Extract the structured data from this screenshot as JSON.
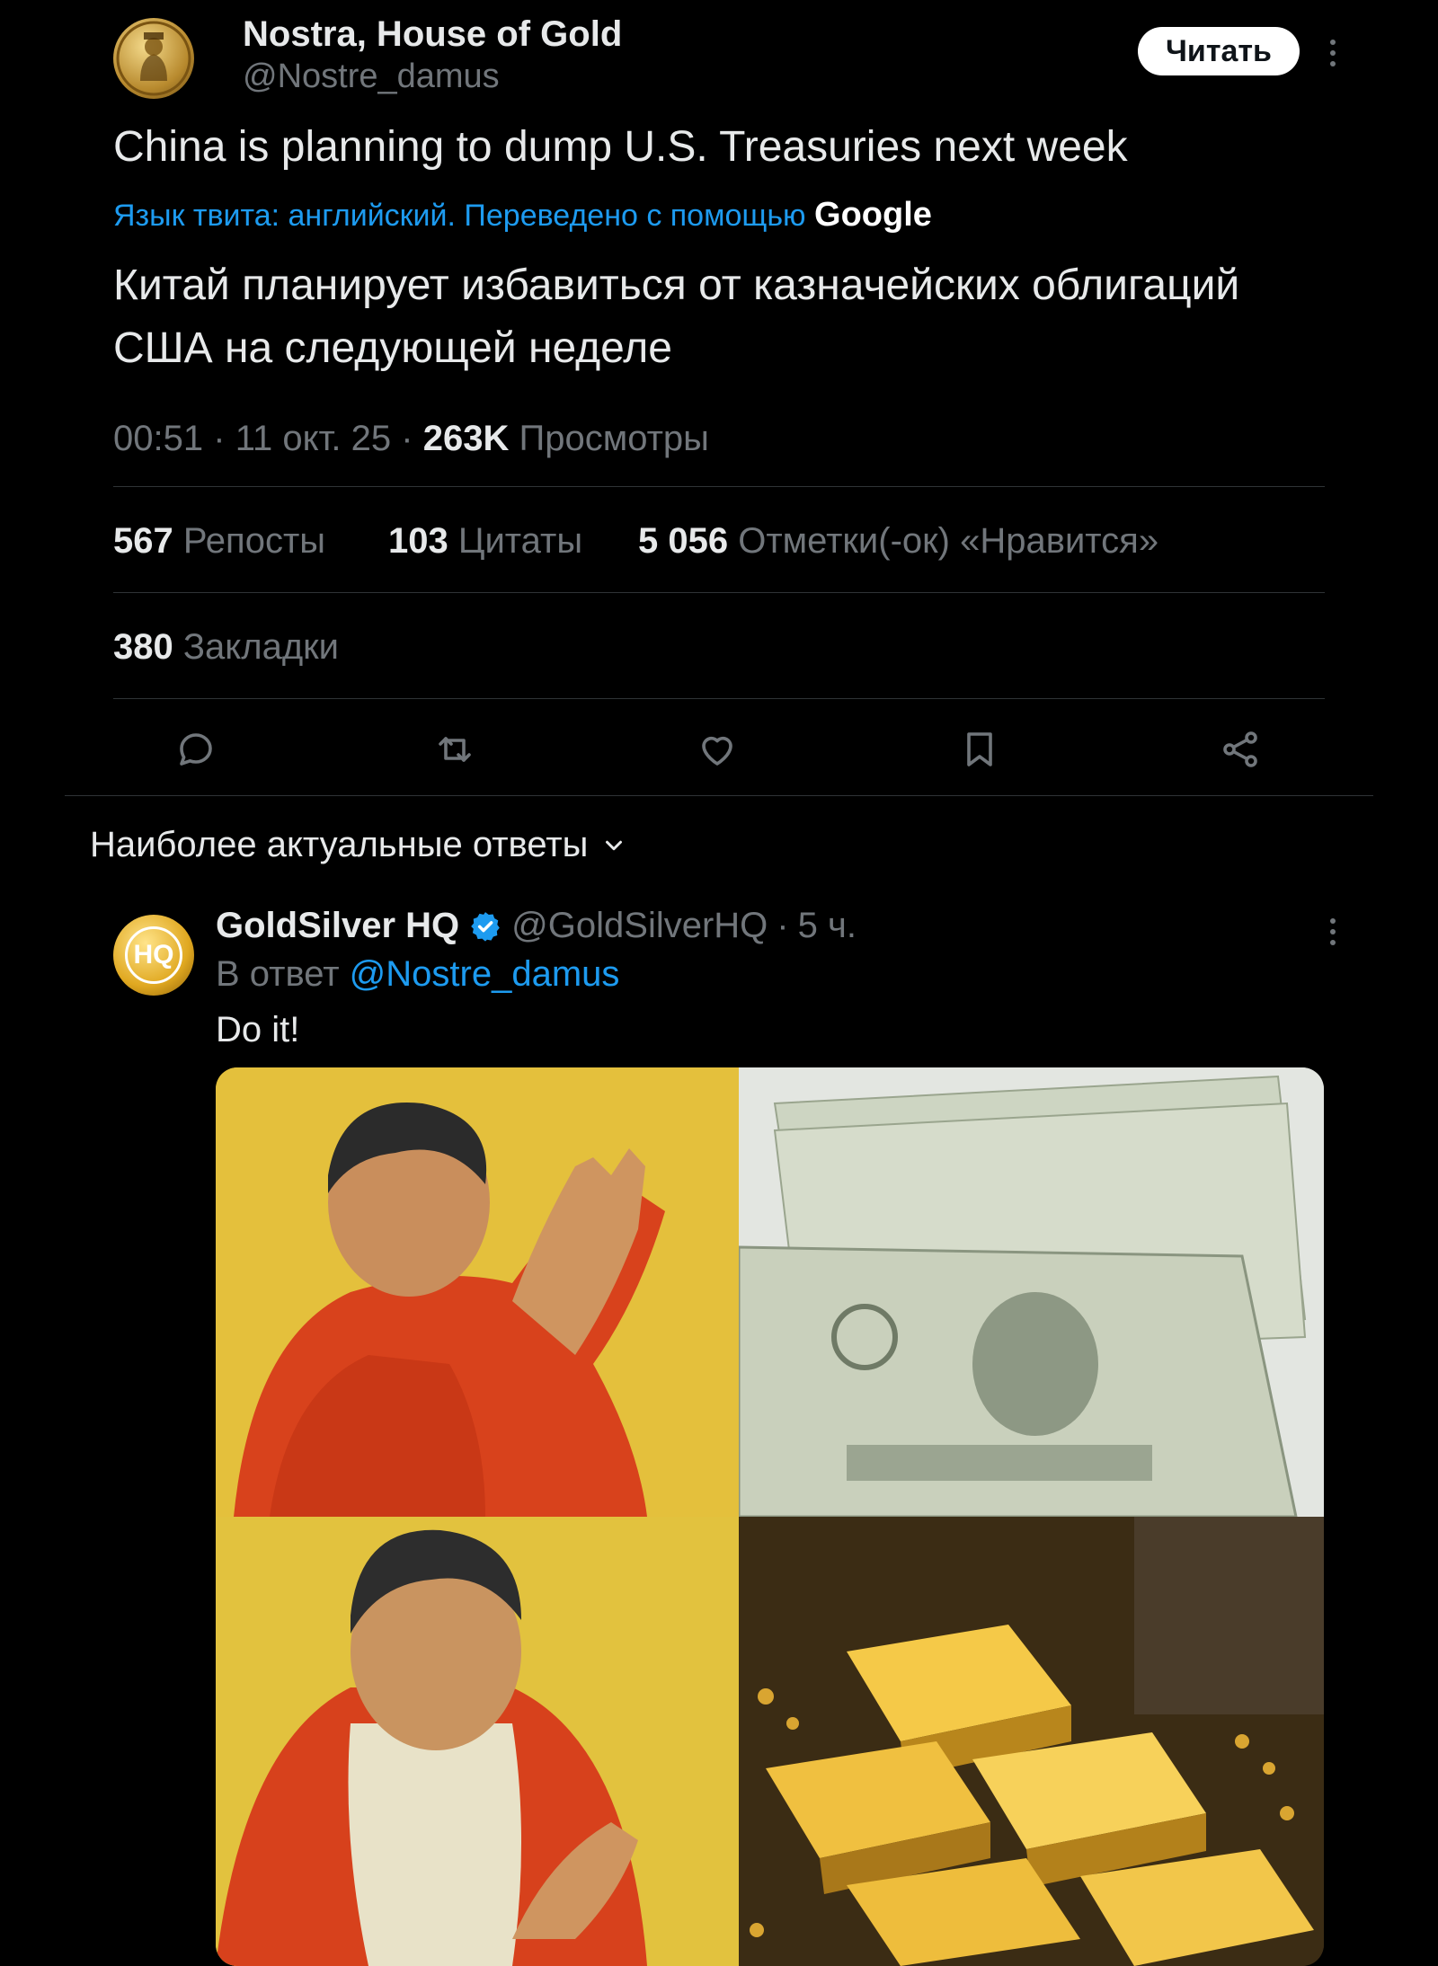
{
  "tweet": {
    "author_name": "Nostra, House of Gold",
    "author_handle": "@Nostre_damus",
    "follow_label": "Читать",
    "text": "China is planning to dump U.S. Treasuries next week",
    "translation_notice": "Язык твита: английский. Переведено с помощью",
    "translation_provider": "Google",
    "translated_line1": "Китай планирует избавиться от казначейских облигаций",
    "translated_line2": "США на следующей неделе",
    "time": "00:51",
    "date": "11 окт. 25",
    "separator": "·",
    "views_count": "263K",
    "views_label": "Просмотры",
    "reposts_count": "567",
    "reposts_label": "Репосты",
    "quotes_count": "103",
    "quotes_label": "Цитаты",
    "likes_count": "5 056",
    "likes_label": "Отметки(-ок) «Нравится»",
    "bookmarks_count": "380",
    "bookmarks_label": "Закладки"
  },
  "actions": [
    "reply-icon",
    "retweet-icon",
    "heart-icon",
    "bookmark-icon",
    "share-icon"
  ],
  "replies_sort": {
    "label": "Наиболее актуальные ответы"
  },
  "reply": {
    "author_name": "GoldSilver HQ",
    "author_handle": "@GoldSilverHQ",
    "separator": "·",
    "time_ago": "5 ч.",
    "reply_to_prefix": "В ответ",
    "reply_to_handle": "@Nostre_damus",
    "text": "Do it!",
    "avatar_text": "HQ"
  },
  "colors": {
    "background": "#000000",
    "text": "#e7e9ea",
    "muted": "#71767b",
    "accent": "#1d9bf0",
    "divider": "#2f3336"
  }
}
